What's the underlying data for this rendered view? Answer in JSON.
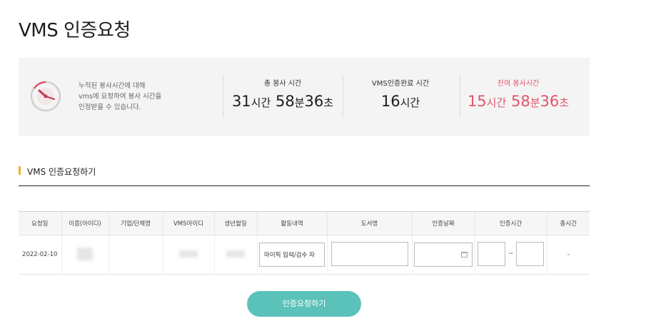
{
  "page": {
    "title": "VMS 인증요청"
  },
  "summary": {
    "description": "누적된 봉사시간에 대해\nvms에 요청하여 봉사 시간을\n인정받을 수 있습니다.",
    "total": {
      "label": "총 봉사 시간",
      "hours": "31",
      "hours_unit": "시간",
      "minutes": "58",
      "minutes_unit": "분",
      "seconds": "36",
      "seconds_unit": "초"
    },
    "completed": {
      "label": "VMS인증완료 시간",
      "hours": "16",
      "hours_unit": "시간"
    },
    "remaining": {
      "label": "잔여 봉사시간",
      "hours": "15",
      "hours_unit": "시간",
      "minutes": "58",
      "minutes_unit": "분",
      "seconds": "36",
      "seconds_unit": "초",
      "color": "#e4536a"
    }
  },
  "section": {
    "title": "VMS 인증요청하기"
  },
  "table": {
    "headers": [
      "요청일",
      "이름(아이디)",
      "기업/단체명",
      "VMS아이디",
      "생년월일",
      "활동내역",
      "도서명",
      "인증날짜",
      "인증시간",
      "총시간"
    ],
    "row": {
      "date": "2022-02-10",
      "activity": "마이픽 입력/검수 자",
      "book": "",
      "cert_date": "",
      "time_from": "",
      "time_sep": "~",
      "time_to": "",
      "total": "-"
    }
  },
  "submit": {
    "label": "인증요청하기",
    "color": "#5bc2b9"
  },
  "icons": {
    "clock": "clock-icon",
    "calendar": "calendar-icon"
  }
}
